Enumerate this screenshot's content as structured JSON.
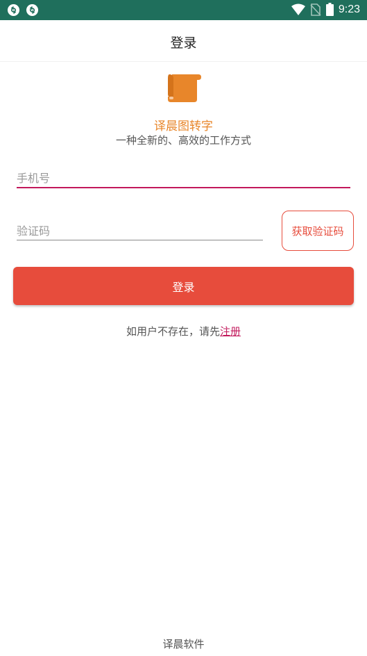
{
  "status_bar": {
    "time": "9:23",
    "background_color": "#1f6f5c",
    "left_icons": [
      "sync-icon",
      "sync-icon"
    ],
    "right_icons": [
      "wifi-icon",
      "no-sim-icon",
      "battery-icon"
    ]
  },
  "app_bar": {
    "title": "登录"
  },
  "brand": {
    "logo_icon": "scroll-icon",
    "logo_color": "#e8862a",
    "name": "译晨图转字",
    "slogan": "一种全新的、高效的工作方式"
  },
  "form": {
    "phone_placeholder": "手机号",
    "phone_value": "",
    "code_placeholder": "验证码",
    "code_value": "",
    "get_code_label": "获取验证码",
    "login_label": "登录",
    "accent_color": "#e74c3c",
    "focus_color": "#c2185b"
  },
  "register": {
    "prefix": "如用户不存在，请先",
    "link_label": "注册"
  },
  "footer": {
    "company": "译晨软件"
  }
}
